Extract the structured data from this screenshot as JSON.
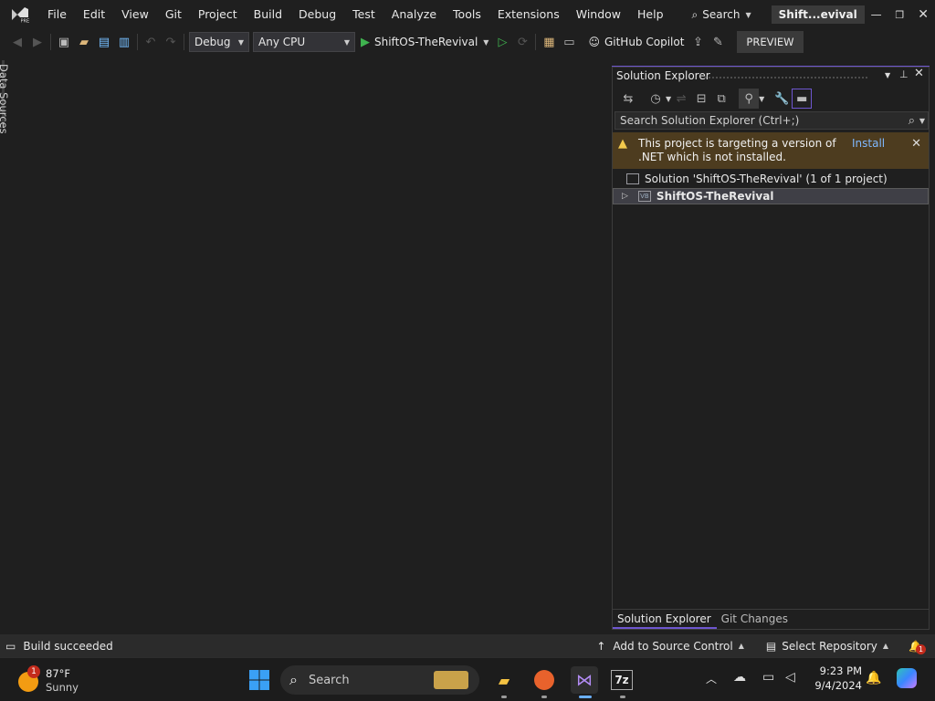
{
  "menu": [
    "File",
    "Edit",
    "View",
    "Git",
    "Project",
    "Build",
    "Debug",
    "Test",
    "Analyze",
    "Tools",
    "Extensions",
    "Window",
    "Help"
  ],
  "title_search": "Search",
  "window_title": "Shift...evival",
  "toolbar": {
    "config": "Debug",
    "platform": "Any CPU",
    "run_target": "ShiftOS-TheRevival",
    "copilot": "GitHub Copilot",
    "preview": "PREVIEW"
  },
  "left_tab": "Data Sources",
  "solution_explorer": {
    "title": "Solution Explorer",
    "search_placeholder": "Search Solution Explorer (Ctrl+;)",
    "warning_text": "This project is targeting a version of .NET which is not installed.",
    "warning_link": "Install",
    "solution_node": "Solution 'ShiftOS-TheRevival' (1 of 1 project)",
    "project_node": "ShiftOS-TheRevival",
    "tabs": [
      "Solution Explorer",
      "Git Changes"
    ]
  },
  "status": {
    "message": "Build succeeded",
    "source_control": "Add to Source Control",
    "repository": "Select Repository",
    "notif_count": "1"
  },
  "taskbar": {
    "weather_temp": "87°F",
    "weather_desc": "Sunny",
    "weather_badge": "1",
    "search": "Search",
    "time": "9:23 PM",
    "date": "9/4/2024"
  },
  "colors": {
    "accent": "#6e56cf",
    "warning_bg": "#4d3c1f",
    "link": "#7fb8ff",
    "run": "#3fb34f"
  }
}
